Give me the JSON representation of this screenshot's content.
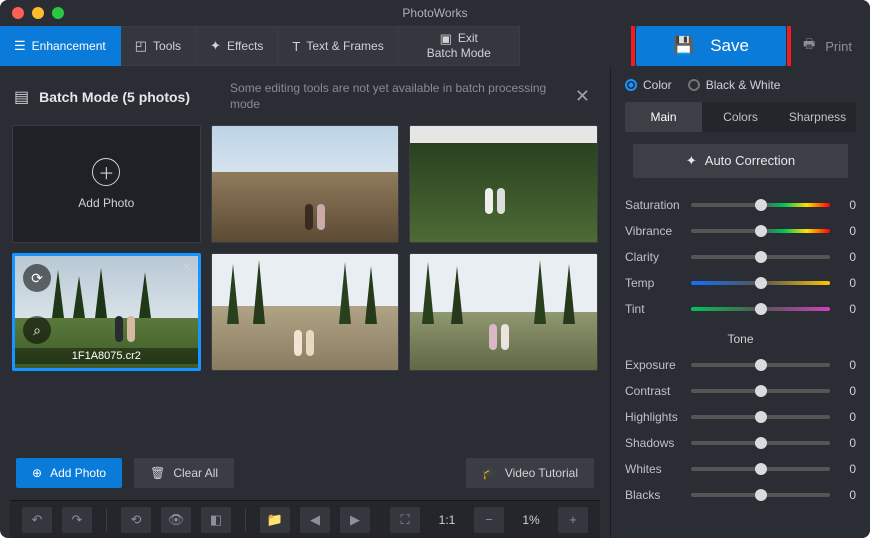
{
  "app_title": "PhotoWorks",
  "tabs": {
    "enhancement": "Enhancement",
    "tools": "Tools",
    "effects": "Effects",
    "text_frames": "Text & Frames",
    "exit_l1": "Exit",
    "exit_l2": "Batch Mode"
  },
  "actions": {
    "save": "Save",
    "print": "Print"
  },
  "batch": {
    "title": "Batch Mode (5 photos)",
    "message": "Some editing tools are not yet available in batch processing mode",
    "add_photo_tile": "Add Photo",
    "selected_filename": "1F1A8075.cr2",
    "add_photo_btn": "Add Photo",
    "clear_all_btn": "Clear All",
    "tutorial_btn": "Video Tutorial"
  },
  "zoom": {
    "ratio": "1:1",
    "percent": "1%"
  },
  "color_mode": {
    "color": "Color",
    "bw": "Black & White"
  },
  "subtabs": {
    "main": "Main",
    "colors": "Colors",
    "sharpness": "Sharpness"
  },
  "auto_correction": "Auto Correction",
  "sliders": {
    "saturation": {
      "label": "Saturation",
      "value": "0"
    },
    "vibrance": {
      "label": "Vibrance",
      "value": "0"
    },
    "clarity": {
      "label": "Clarity",
      "value": "0"
    },
    "temp": {
      "label": "Temp",
      "value": "0"
    },
    "tint": {
      "label": "Tint",
      "value": "0"
    }
  },
  "tone_header": "Tone",
  "tone": {
    "exposure": {
      "label": "Exposure",
      "value": "0"
    },
    "contrast": {
      "label": "Contrast",
      "value": "0"
    },
    "highlights": {
      "label": "Highlights",
      "value": "0"
    },
    "shadows": {
      "label": "Shadows",
      "value": "0"
    },
    "whites": {
      "label": "Whites",
      "value": "0"
    },
    "blacks": {
      "label": "Blacks",
      "value": "0"
    }
  }
}
